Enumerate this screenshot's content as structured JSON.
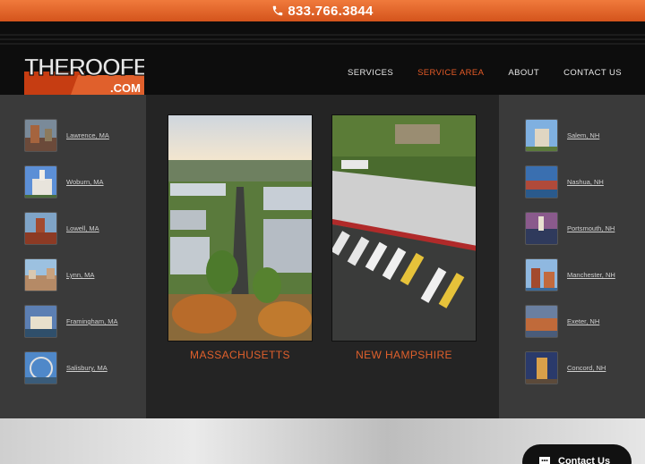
{
  "topbar": {
    "phone": "833.766.3844"
  },
  "logo": {
    "line1": "THEROOFERS",
    "line2": ".COM"
  },
  "nav": [
    {
      "label": "SERVICES",
      "active": false
    },
    {
      "label": "SERVICE AREA",
      "active": true
    },
    {
      "label": "ABOUT",
      "active": false
    },
    {
      "label": "CONTACT US",
      "active": false
    }
  ],
  "cities_left": [
    {
      "label": "Lawrence, MA",
      "icon": "city-photo-icon"
    },
    {
      "label": "Woburn, MA",
      "icon": "city-photo-icon"
    },
    {
      "label": "Lowell, MA",
      "icon": "city-photo-icon"
    },
    {
      "label": "Lynn, MA",
      "icon": "city-photo-icon"
    },
    {
      "label": "Framingham, MA",
      "icon": "city-photo-icon"
    },
    {
      "label": "Salisbury, MA",
      "icon": "city-photo-icon"
    }
  ],
  "cities_right": [
    {
      "label": "Salem, NH",
      "icon": "city-photo-icon"
    },
    {
      "label": "Nashua, NH",
      "icon": "city-photo-icon"
    },
    {
      "label": "Portsmouth, NH",
      "icon": "city-photo-icon"
    },
    {
      "label": "Manchester, NH",
      "icon": "city-photo-icon"
    },
    {
      "label": "Exeter, NH",
      "icon": "city-photo-icon"
    },
    {
      "label": "Concord, NH",
      "icon": "city-photo-icon"
    }
  ],
  "states": [
    {
      "label": "MASSACHUSETTS"
    },
    {
      "label": "NEW HAMPSHIRE"
    }
  ],
  "chat": {
    "label": "Contact Us"
  },
  "colors": {
    "accent": "#e55a26",
    "topbar": "#e0652c",
    "dark": "#0d0d0d"
  }
}
